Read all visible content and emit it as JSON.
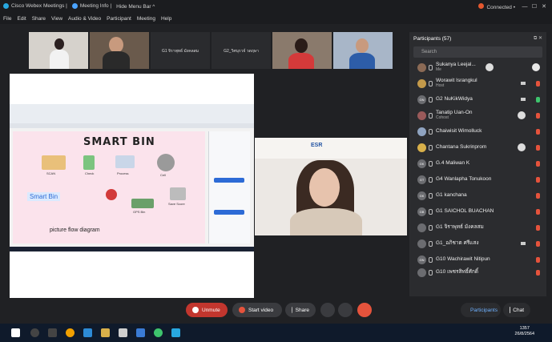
{
  "titlebar": {
    "app": "Cisco Webex Meetings",
    "meeting_info": "Meeting Info",
    "hide_menu": "Hide Menu Bar ^",
    "connected": "Connected •",
    "win_min": "—",
    "win_max": "☐",
    "win_close": "✕"
  },
  "menubar": {
    "items": [
      "File",
      "Edit",
      "Share",
      "View",
      "Audio & Video",
      "Participant",
      "Meeting",
      "Help"
    ]
  },
  "thumbnails": [
    {
      "label": ""
    },
    {
      "label": ""
    },
    {
      "label": "G1 จิราพุทธ์ มังคลสม"
    },
    {
      "label": "G2_วิศนุรวจ์ วดฤษา"
    },
    {
      "label": ""
    },
    {
      "label": ""
    }
  ],
  "slide": {
    "title": "SMART BIN",
    "subtitle": "picture flow diagram",
    "smart_bin_label": "Smart Bin",
    "nodes": {
      "scan": "SCAN",
      "check": "Check",
      "process": "Process",
      "gps": "GPS Bin",
      "save": "Save Score",
      "cell": "Cell"
    }
  },
  "speaker": {
    "banner": "ESR"
  },
  "participants": {
    "title": "Participants (57)",
    "search_placeholder": "Search",
    "list": [
      {
        "name": "Sukanya Leejal...",
        "role": "Me",
        "initials": ""
      },
      {
        "name": "Worawit Israngkul",
        "role": "Host",
        "initials": ""
      },
      {
        "name": "G2 NuKikWidya",
        "role": "",
        "initials": "GN"
      },
      {
        "name": "Tanatip Uan-On",
        "role": "Cohost",
        "initials": ""
      },
      {
        "name": "Chaiwisit Wimolluck",
        "role": "",
        "initials": ""
      },
      {
        "name": "Chantana Sukrinprom",
        "role": "",
        "initials": ""
      },
      {
        "name": "G.4 Maliwan K",
        "role": "",
        "initials": "GK"
      },
      {
        "name": "G4 Wanlapha Tonukoon",
        "role": "",
        "initials": "GT"
      },
      {
        "name": "G1 kanchana",
        "role": "",
        "initials": "GK"
      },
      {
        "name": "G1 SAICHOL BUACHAN",
        "role": "",
        "initials": "GB"
      },
      {
        "name": "G1 จิราพุทธ์ มังคลสม",
        "role": "",
        "initials": ""
      },
      {
        "name": "G1_อภิชาต ศรีแสง",
        "role": "",
        "initials": ""
      },
      {
        "name": "G10 Wachirawit Nitipun",
        "role": "",
        "initials": "GN"
      },
      {
        "name": "G10 เพชรสิทธิ์ศักดิ์",
        "role": "",
        "initials": ""
      }
    ]
  },
  "controls": {
    "unmute": "Unmute",
    "start_video": "Start video",
    "share": "Share",
    "participants": "Participants",
    "chat": "Chat"
  },
  "taskbar": {
    "time": "1357",
    "date": "26/8/2564"
  }
}
